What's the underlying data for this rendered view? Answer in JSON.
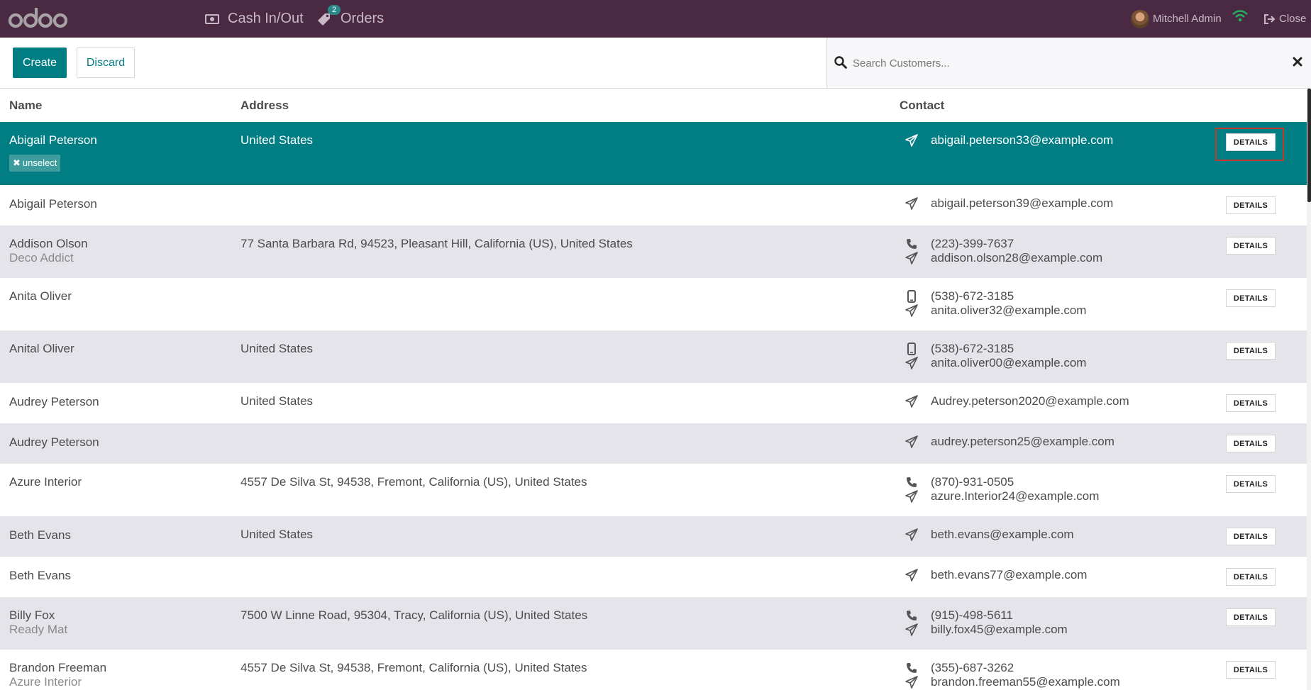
{
  "navbar": {
    "logo": "odoo",
    "cash_label": "Cash In/Out",
    "orders_label": "Orders",
    "orders_badge": "2",
    "user_name": "Mitchell Admin",
    "close_label": "Close"
  },
  "controls": {
    "create_label": "Create",
    "discard_label": "Discard",
    "search_placeholder": "Search Customers..."
  },
  "table": {
    "headers": {
      "name": "Name",
      "address": "Address",
      "contact": "Contact"
    },
    "details_label": "DETAILS",
    "unselect_label": "unselect",
    "rows": [
      {
        "name": "Abigail Peterson",
        "company": "",
        "address": "United States",
        "phone": "",
        "phone_type": "",
        "email": "abigail.peterson33@example.com",
        "selected": true
      },
      {
        "name": "Abigail Peterson",
        "company": "",
        "address": "",
        "phone": "",
        "phone_type": "",
        "email": "abigail.peterson39@example.com"
      },
      {
        "name": "Addison Olson",
        "company": "Deco Addict",
        "address": "77 Santa Barbara Rd, 94523, Pleasant Hill, California (US), United States",
        "phone": "(223)-399-7637",
        "phone_type": "phone",
        "email": "addison.olson28@example.com"
      },
      {
        "name": "Anita Oliver",
        "company": "",
        "address": "",
        "phone": "(538)-672-3185",
        "phone_type": "mobile",
        "email": "anita.oliver32@example.com"
      },
      {
        "name": "Anital Oliver",
        "company": "",
        "address": "United States",
        "phone": "(538)-672-3185",
        "phone_type": "mobile",
        "email": "anita.oliver00@example.com"
      },
      {
        "name": "Audrey Peterson",
        "company": "",
        "address": "United States",
        "phone": "",
        "phone_type": "",
        "email": "Audrey.peterson2020@example.com"
      },
      {
        "name": "Audrey Peterson",
        "company": "",
        "address": "",
        "phone": "",
        "phone_type": "",
        "email": "audrey.peterson25@example.com"
      },
      {
        "name": "Azure Interior",
        "company": "",
        "address": "4557 De Silva St, 94538, Fremont, California (US), United States",
        "phone": "(870)-931-0505",
        "phone_type": "phone",
        "email": "azure.Interior24@example.com"
      },
      {
        "name": "Beth Evans",
        "company": "",
        "address": "United States",
        "phone": "",
        "phone_type": "",
        "email": "beth.evans@example.com"
      },
      {
        "name": "Beth Evans",
        "company": "",
        "address": "",
        "phone": "",
        "phone_type": "",
        "email": "beth.evans77@example.com"
      },
      {
        "name": "Billy Fox",
        "company": "Ready Mat",
        "address": "7500 W Linne Road, 95304, Tracy, California (US), United States",
        "phone": "(915)-498-5611",
        "phone_type": "phone",
        "email": "billy.fox45@example.com"
      },
      {
        "name": "Brandon Freeman",
        "company": "Azure Interior",
        "address": "4557 De Silva St, 94538, Fremont, California (US), United States",
        "phone": "(355)-687-3262",
        "phone_type": "phone",
        "email": "brandon.freeman55@example.com"
      }
    ]
  },
  "colors": {
    "navbar": "#4a2a43",
    "primary": "#017e84",
    "row_alt": "#e4e4ea",
    "highlight": "#c0392b"
  }
}
